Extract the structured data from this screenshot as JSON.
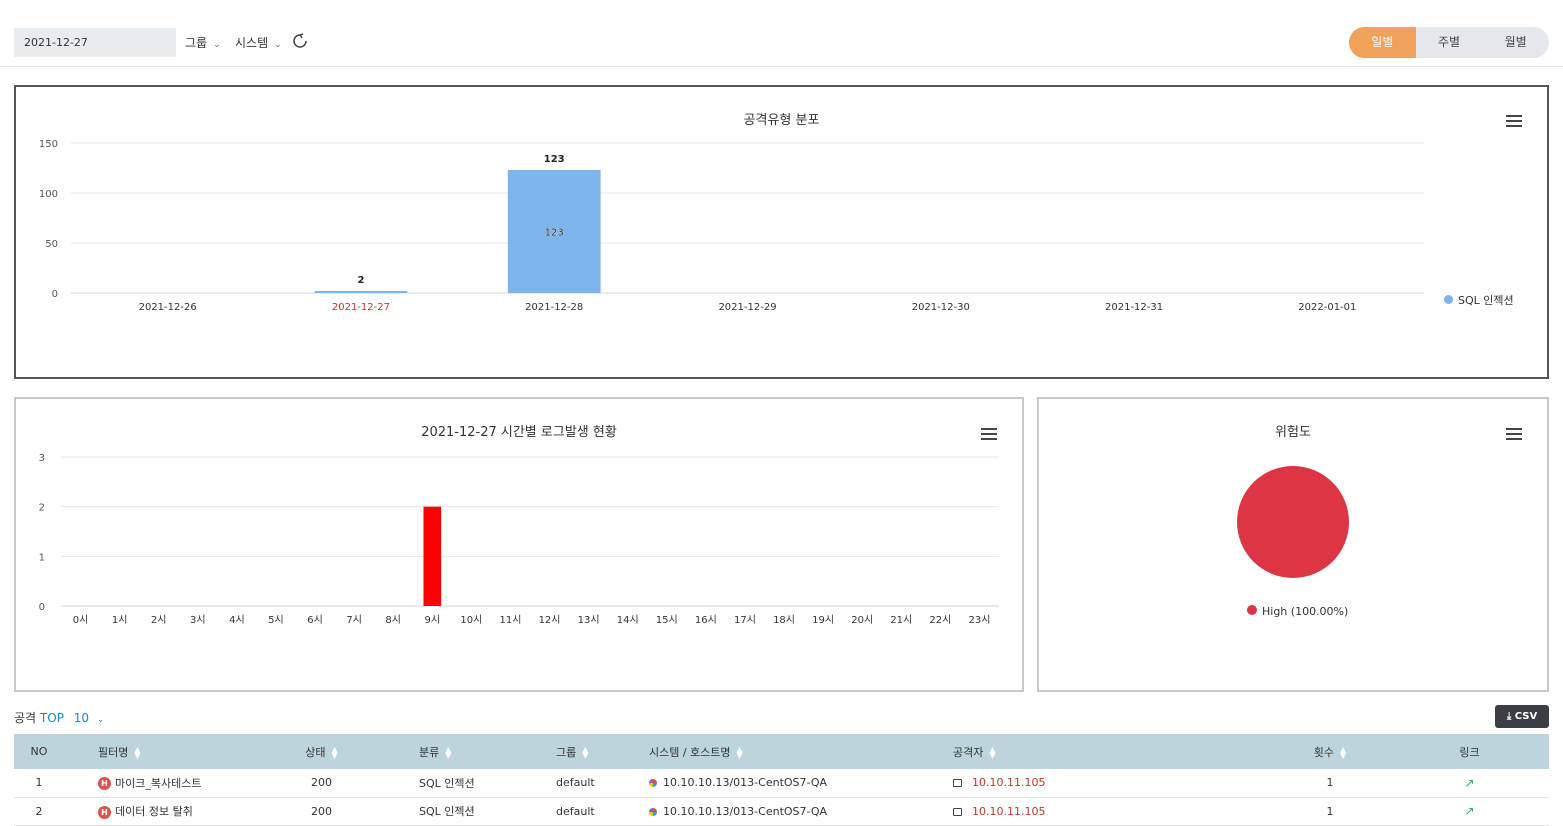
{
  "toolbar": {
    "date_value": "2021-12-27",
    "group_label": "그룹",
    "system_label": "시스템",
    "period_tabs": [
      {
        "label": "일별",
        "active": true
      },
      {
        "label": "주별",
        "active": false
      },
      {
        "label": "월별",
        "active": false
      }
    ],
    "accent_color": "#f0a15a"
  },
  "attack_type_chart": {
    "title": "공격유형 분포",
    "legend": "SQL 인젝션",
    "color": "#7cb5ec"
  },
  "hourly_chart": {
    "title": "2021-12-27 시간별 로그발생 현황",
    "color": "#ff0000"
  },
  "risk_chart": {
    "title": "위험도",
    "legend": "High (100.00%)",
    "color": "#dc3545"
  },
  "chart_data": [
    {
      "type": "bar",
      "title": "공격유형 분포",
      "categories": [
        "2021-12-26",
        "2021-12-27",
        "2021-12-28",
        "2021-12-29",
        "2021-12-30",
        "2021-12-31",
        "2022-01-01"
      ],
      "highlight_category": "2021-12-27",
      "series": [
        {
          "name": "SQL 인젝션",
          "values": [
            0,
            2,
            123,
            0,
            0,
            0,
            0
          ]
        }
      ],
      "yticks": [
        "0",
        "50",
        "100",
        "150"
      ],
      "ylim": [
        0,
        150
      ],
      "legend": "right"
    },
    {
      "type": "bar",
      "title": "2021-12-27 시간별 로그발생 현황",
      "categories": [
        "0시",
        "1시",
        "2시",
        "3시",
        "4시",
        "5시",
        "6시",
        "7시",
        "8시",
        "9시",
        "10시",
        "11시",
        "12시",
        "13시",
        "14시",
        "15시",
        "16시",
        "17시",
        "18시",
        "19시",
        "20시",
        "21시",
        "22시",
        "23시"
      ],
      "values": [
        0,
        0,
        0,
        0,
        0,
        0,
        0,
        0,
        0,
        2,
        0,
        0,
        0,
        0,
        0,
        0,
        0,
        0,
        0,
        0,
        0,
        0,
        0,
        0
      ],
      "yticks": [
        "0",
        "1",
        "2",
        "3"
      ],
      "ylim": [
        0,
        3
      ]
    },
    {
      "type": "pie",
      "title": "위험도",
      "slices": [
        {
          "label": "High (100.00%)",
          "value": 100
        }
      ]
    }
  ],
  "top_section": {
    "prefix": "공격",
    "top_label": "TOP",
    "top_count": "10",
    "csv_label": "CSV"
  },
  "table": {
    "headers": [
      "NO",
      "필터명",
      "상태",
      "분류",
      "그룹",
      "시스템 / 호스트명",
      "공격자",
      "횟수",
      "링크"
    ],
    "rows": [
      {
        "no": "1",
        "filter": "마이크_복사테스트",
        "status": "200",
        "category": "SQL 인젝션",
        "group": "default",
        "system": "10.10.10.13/013-CentOS7-QA",
        "attacker": "10.10.11.105",
        "count": "1"
      },
      {
        "no": "2",
        "filter": "데이터 정보 탈취",
        "status": "200",
        "category": "SQL 인젝션",
        "group": "default",
        "system": "10.10.10.13/013-CentOS7-QA",
        "attacker": "10.10.11.105",
        "count": "1"
      }
    ]
  }
}
